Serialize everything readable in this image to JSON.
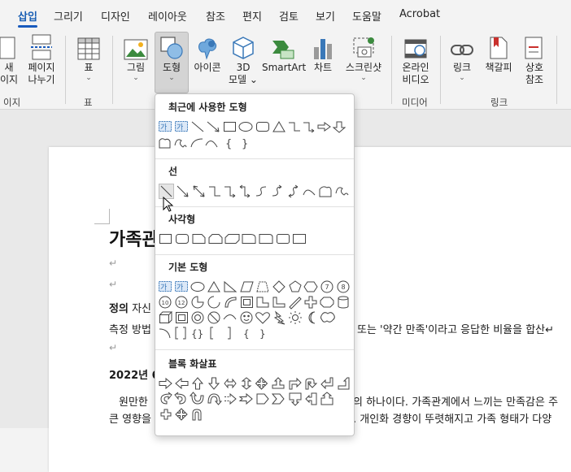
{
  "menu": {
    "tabs": [
      "삽입",
      "그리기",
      "디자인",
      "레이아웃",
      "참조",
      "편지",
      "검토",
      "보기",
      "도움말",
      "Acrobat"
    ],
    "active_tab": "삽입"
  },
  "ribbon": {
    "page_group": {
      "new_label_1": "새",
      "new_label_2": "이지",
      "break_label_1": "페이지",
      "break_label_2": "나누기",
      "group": "이지"
    },
    "table": {
      "label": "표",
      "group": "표"
    },
    "illustrations": {
      "picture": "그림",
      "shapes": "도형",
      "icons": "아이콘",
      "model_line1": "3D",
      "model_line2": "모델",
      "smartart": "SmartArt",
      "chart": "차트",
      "screenshot": "스크린샷"
    },
    "media": {
      "label_1": "온라인",
      "label_2": "비디오",
      "group": "미디어"
    },
    "links": {
      "link": "링크",
      "bookmark": "책갈피",
      "cross_ref_1": "상호",
      "cross_ref_2": "참조",
      "group": "링크"
    },
    "colors": {
      "accent": "#185abd",
      "pressed": "#d4d4d4"
    }
  },
  "shapes_menu": {
    "sections": [
      "최근에 사용한 도형",
      "선",
      "사각형",
      "기본 도형",
      "블록 화살표"
    ],
    "text_box_glyph": "가"
  },
  "document": {
    "title": "가족관",
    "para_mark": "↵",
    "line_def_bold": "정의",
    "line_def_rest": "자신",
    "line_measure_left": "측정 방법",
    "line_measure_right": "또는 '약간 만족'이라고 응답한 비율을 합산↵",
    "year_heading": "2022년 6",
    "body_left_1": "원만한",
    "body_right_1": "의 하나이다. 가족관계에서 느끼는 만족감은 주",
    "body_left_2": "큰 영향을",
    "body_right_2": ". 개인화 경향이 뚜렷해지고 가족 형태가 다양"
  }
}
